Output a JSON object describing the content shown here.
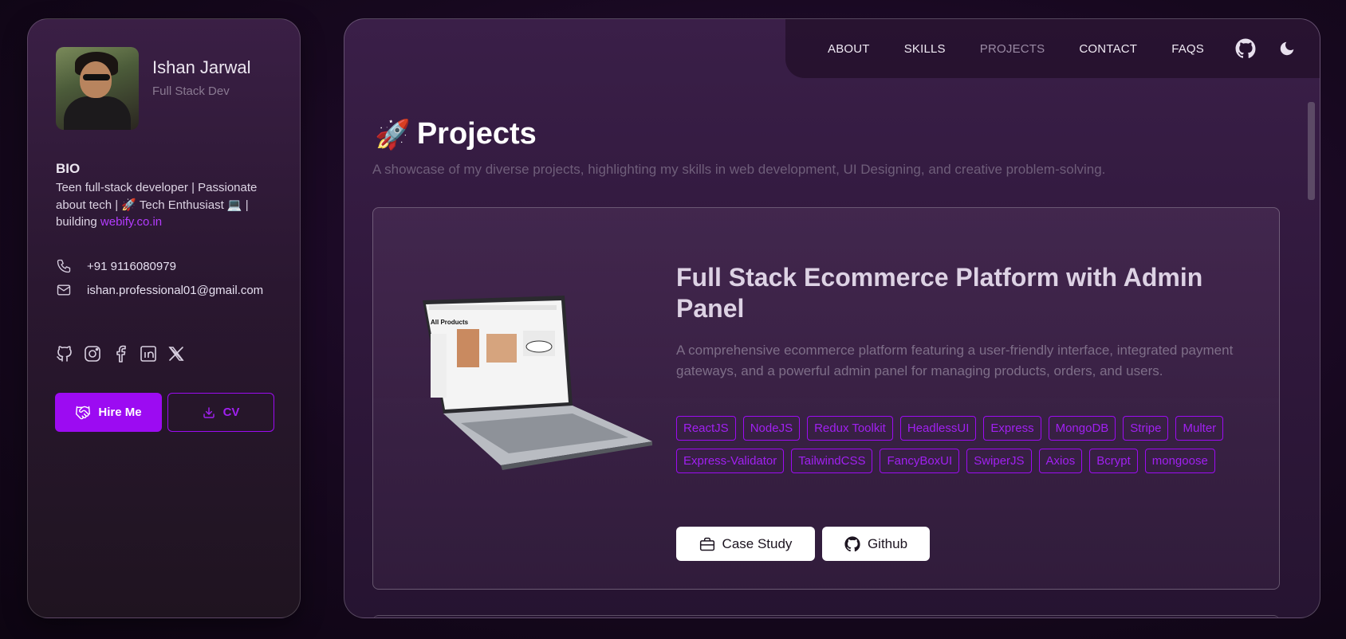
{
  "profile": {
    "name": "Ishan Jarwal",
    "role": "Full Stack Dev",
    "bio_title": "BIO",
    "bio_text": "Teen full-stack developer | Passionate about tech | 🚀 Tech Enthusiast 💻 | building",
    "bio_link": "webify.co.in",
    "phone": "+91 9116080979",
    "email": "ishan.professional01@gmail.com",
    "socials": [
      "github-icon",
      "instagram-icon",
      "facebook-icon",
      "linkedin-icon",
      "x-icon"
    ],
    "hire_label": "Hire Me",
    "cv_label": "CV"
  },
  "nav": {
    "items": [
      "ABOUT",
      "SKILLS",
      "PROJECTS",
      "CONTACT",
      "FAQS"
    ],
    "active": "PROJECTS"
  },
  "page": {
    "emoji": "🚀",
    "title": "Projects",
    "subtitle": "A showcase of my diverse projects, highlighting my skills in web development, UI Designing, and creative problem-solving."
  },
  "project": {
    "title": "Full Stack Ecommerce Platform with Admin Panel",
    "description": "A comprehensive ecommerce platform featuring a user-friendly interface, integrated payment gateways, and a powerful admin panel for managing products, orders, and users.",
    "tags": [
      "ReactJS",
      "NodeJS",
      "Redux Toolkit",
      "HeadlessUI",
      "Express",
      "MongoDB",
      "Stripe",
      "Multer",
      "Express-Validator",
      "TailwindCSS",
      "FancyBoxUI",
      "SwiperJS",
      "Axios",
      "Bcrypt",
      "mongoose"
    ],
    "case_study_label": "Case Study",
    "github_label": "Github",
    "screen_title": "All Products"
  },
  "colors": {
    "accent": "#9c0bf2",
    "background": "#17081f"
  }
}
